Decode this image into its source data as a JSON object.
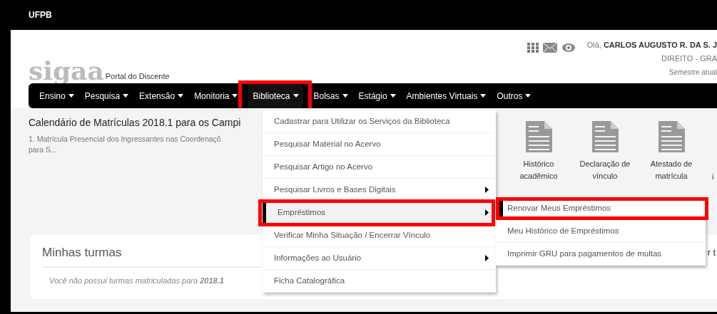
{
  "top_bar": {
    "title": "UFPB"
  },
  "header": {
    "logo": "sigaa",
    "subtitle": "Portal do Discente",
    "greeting": "Olá,",
    "user_name": "CARLOS AUGUSTO R. DA S. J",
    "course": "DIREITO - GRA",
    "semester": "Semestre atual"
  },
  "nav": [
    {
      "label": "Ensino",
      "selected": false,
      "highlighted": false
    },
    {
      "label": "Pesquisa",
      "selected": false,
      "highlighted": false
    },
    {
      "label": "Extensão",
      "selected": false,
      "highlighted": false
    },
    {
      "label": "Monitoria",
      "selected": false,
      "highlighted": false
    },
    {
      "label": "Biblioteca",
      "selected": true,
      "highlighted": true
    },
    {
      "label": "Bolsas",
      "selected": false,
      "highlighted": false
    },
    {
      "label": "Estágio",
      "selected": false,
      "highlighted": false
    },
    {
      "label": "Ambientes Virtuais",
      "selected": false,
      "highlighted": false
    },
    {
      "label": "Outros",
      "selected": false,
      "highlighted": false
    }
  ],
  "dropdown": [
    {
      "label": "Cadastrar para Utilizar os Serviços da Biblioteca",
      "has_submenu": false,
      "selected": false,
      "highlighted": false
    },
    {
      "label": "Pesquisar Material no Acervo",
      "has_submenu": false,
      "selected": false,
      "highlighted": false
    },
    {
      "label": "Pesquisar Artigo no Acervo",
      "has_submenu": false,
      "selected": false,
      "highlighted": false
    },
    {
      "label": "Pesquisar Livros e Bases Digitais",
      "has_submenu": true,
      "selected": false,
      "highlighted": false
    },
    {
      "label": "Empréstimos",
      "has_submenu": true,
      "selected": true,
      "highlighted": true
    },
    {
      "label": "Verificar Minha Situação / Encerrar Vínculo",
      "has_submenu": false,
      "selected": false,
      "highlighted": false
    },
    {
      "label": "Informações ao Usuário",
      "has_submenu": true,
      "selected": false,
      "highlighted": false
    },
    {
      "label": "Ficha Catalográfica",
      "has_submenu": false,
      "selected": false,
      "highlighted": false
    }
  ],
  "submenu": [
    {
      "label": "Renovar Meus Empréstimos",
      "selected": true,
      "highlighted": true
    },
    {
      "label": "Meu Histórico de Empréstimos",
      "selected": false,
      "highlighted": false
    },
    {
      "label": "Imprimir GRU para pagamentos de multas",
      "selected": false,
      "highlighted": false
    }
  ],
  "news": {
    "title": "Calendário de Matrículas 2018.1 para os Campi",
    "lines": [
      "1. Matrícula Presencial dos Ingressantes nas Coordenaçõ",
      "para S..."
    ]
  },
  "documents": [
    {
      "label": "Histórico acadêmico"
    },
    {
      "label": "Declaração de vínculo"
    },
    {
      "label": "Atestado de matrícula"
    }
  ],
  "documents_partial_label": "i",
  "classes_card": {
    "title": "Minhas turmas",
    "right_text": "r t",
    "message": "Você não possui turmas matriculadas para **2018.1**"
  }
}
